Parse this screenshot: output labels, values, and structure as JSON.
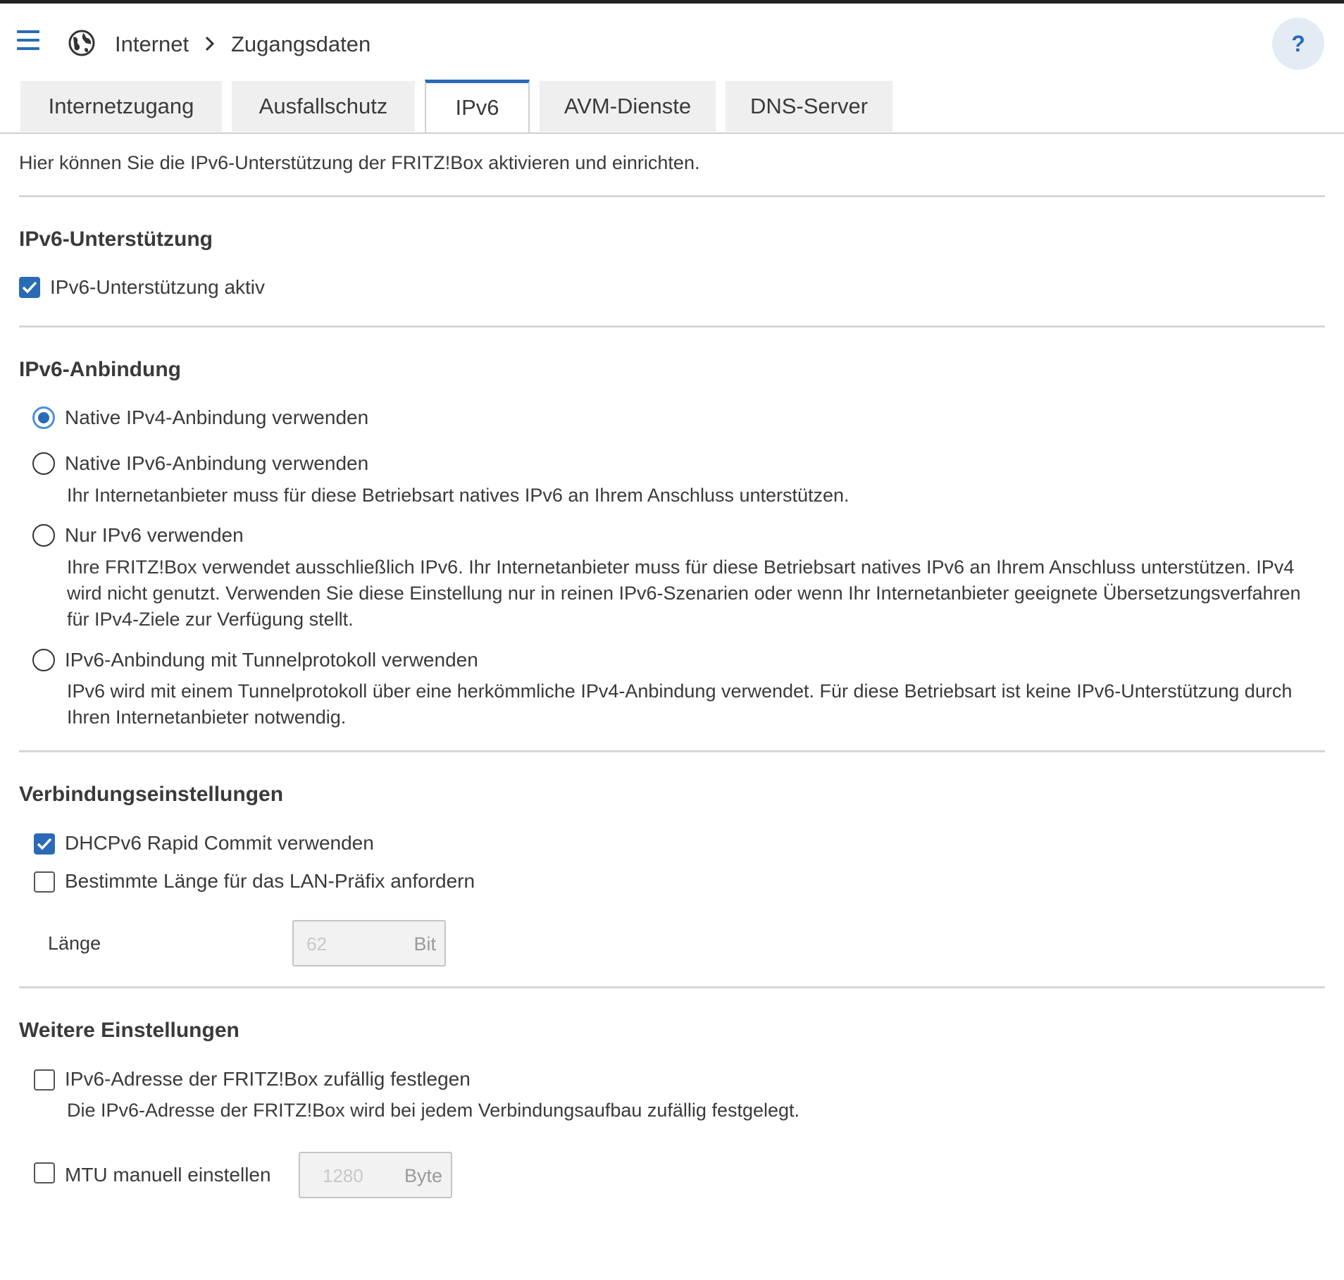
{
  "header": {
    "breadcrumb": [
      "Internet",
      "Zugangsdaten"
    ],
    "help_label": "?"
  },
  "tabs": [
    {
      "label": "Internetzugang",
      "active": false
    },
    {
      "label": "Ausfallschutz",
      "active": false
    },
    {
      "label": "IPv6",
      "active": true
    },
    {
      "label": "AVM-Dienste",
      "active": false
    },
    {
      "label": "DNS-Server",
      "active": false
    }
  ],
  "intro": "Hier können Sie die IPv6-Unterstützung der FRITZ!Box aktivieren und einrichten.",
  "sections": {
    "support": {
      "title": "IPv6-Unterstützung",
      "checkbox_label": "IPv6-Unterstützung aktiv",
      "checked": true
    },
    "binding": {
      "title": "IPv6-Anbindung",
      "options": [
        {
          "label": "Native IPv4-Anbindung verwenden",
          "selected": true,
          "desc": ""
        },
        {
          "label": "Native IPv6-Anbindung verwenden",
          "selected": false,
          "desc": "Ihr Internetanbieter muss für diese Betriebsart natives IPv6 an Ihrem Anschluss unterstützen."
        },
        {
          "label": "Nur IPv6 verwenden",
          "selected": false,
          "desc": "Ihre FRITZ!Box verwendet ausschließlich IPv6. Ihr Internetanbieter muss für diese Betriebsart natives IPv6 an Ihrem Anschluss unterstützen. IPv4 wird nicht genutzt. Verwenden Sie diese Einstellung nur in reinen IPv6-Szenarien oder wenn Ihr Internetanbieter geeignete Übersetzungsverfahren für IPv4-Ziele zur Verfügung stellt."
        },
        {
          "label": "IPv6-Anbindung mit Tunnelprotokoll verwenden",
          "selected": false,
          "desc": "IPv6 wird mit einem Tunnelprotokoll über eine herkömmliche IPv4-Anbindung verwendet. Für diese Betriebsart ist keine IPv6-Unterstützung durch Ihren Internetanbieter notwendig."
        }
      ]
    },
    "connection": {
      "title": "Verbindungseinstellungen",
      "rapid_commit_label": "DHCPv6 Rapid Commit verwenden",
      "rapid_commit_checked": true,
      "prefix_label": "Bestimmte Länge für das LAN-Präfix anfordern",
      "prefix_checked": false,
      "length_label": "Länge",
      "length_value": "62",
      "length_unit": "Bit"
    },
    "further": {
      "title": "Weitere Einstellungen",
      "random_label": "IPv6-Adresse der FRITZ!Box zufällig festlegen",
      "random_checked": false,
      "random_desc": "Die IPv6-Adresse der FRITZ!Box wird bei jedem Verbindungsaufbau zufällig festgelegt.",
      "mtu_label": "MTU manuell einstellen",
      "mtu_checked": false,
      "mtu_value": "1280",
      "mtu_unit": "Byte"
    }
  },
  "colors": {
    "accent": "#2a6bb8",
    "tab_inactive_bg": "#efefef",
    "help_bg": "#e3ebf5",
    "divider": "#d6d6d6"
  }
}
